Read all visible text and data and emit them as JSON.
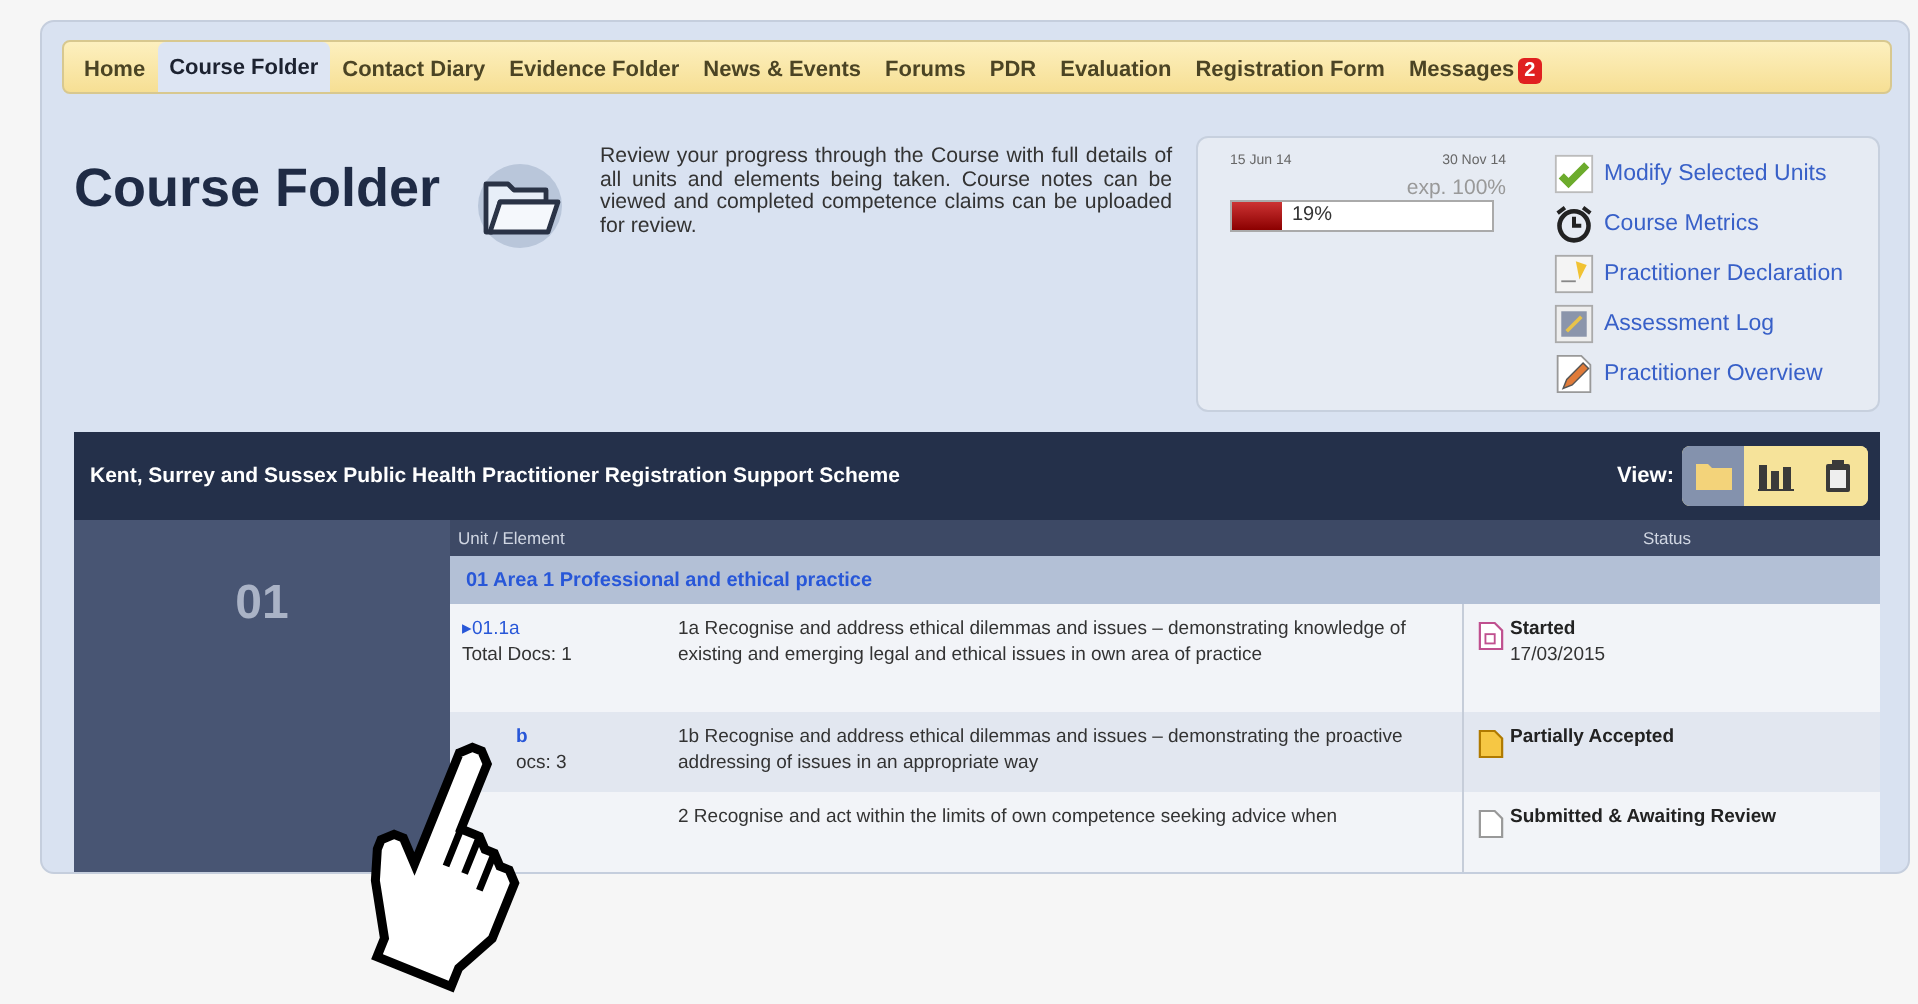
{
  "tabs": [
    {
      "label": "Home",
      "selected": false
    },
    {
      "label": "Course Folder",
      "selected": true
    },
    {
      "label": "Contact Diary",
      "selected": false
    },
    {
      "label": "Evidence Folder",
      "selected": false
    },
    {
      "label": "News & Events",
      "selected": false
    },
    {
      "label": "Forums",
      "selected": false
    },
    {
      "label": "PDR",
      "selected": false
    },
    {
      "label": "Evaluation",
      "selected": false
    },
    {
      "label": "Registration Form",
      "selected": false
    },
    {
      "label": "Messages",
      "selected": false,
      "badge": "2"
    }
  ],
  "page": {
    "title": "Course Folder",
    "description": "Review your progress through the Course with full details of all units and elements being taken. Course notes can be viewed and completed competence claims can be uploaded for review."
  },
  "progress": {
    "start": "15 Jun 14",
    "end": "30 Nov 14",
    "expected": "exp. 100%",
    "level": 0.19,
    "reading": "19%"
  },
  "links": [
    {
      "label": "Modify Selected Units",
      "kind": "check"
    },
    {
      "label": "Course Metrics",
      "kind": "clock"
    },
    {
      "label": "Practitioner Declaration",
      "kind": "declaration"
    },
    {
      "label": "Assessment Log",
      "kind": "log"
    },
    {
      "label": "Practitioner Overview",
      "kind": "overview"
    }
  ],
  "scheme": {
    "title": "Kent, Surrey and Sussex Public Health Practitioner Registration Support Scheme",
    "view_label": "View:",
    "view_buttons": [
      {
        "kind": "folder",
        "selected": true
      },
      {
        "kind": "chart",
        "selected": false
      },
      {
        "kind": "clipboard",
        "selected": false
      }
    ]
  },
  "unit": {
    "number": "01",
    "columns": [
      "Unit / Element",
      "Status"
    ],
    "area": "01 Area 1 Professional and ethical practice",
    "rows": [
      {
        "code": "▸01.1a",
        "docs": "Total Docs: 1",
        "occluded": false,
        "description": "1a Recognise and address ethical dilemmas and issues – demonstrating knowledge of existing and emerging legal and ethical issues in own area of practice",
        "status": "Started",
        "date": "17/03/2015",
        "kind": "started"
      },
      {
        "code": "b",
        "docs": "ocs: 3",
        "occluded": true,
        "description": "1b Recognise and address ethical dilemmas and issues – demonstrating the proactive addressing of issues in an appropriate way",
        "status": "Partially Accepted",
        "kind": "partial"
      },
      {
        "description": "2 Recognise and act within the limits of own competence seeking advice when",
        "status": "Submitted & Awaiting Review",
        "kind": "submitted"
      }
    ]
  }
}
